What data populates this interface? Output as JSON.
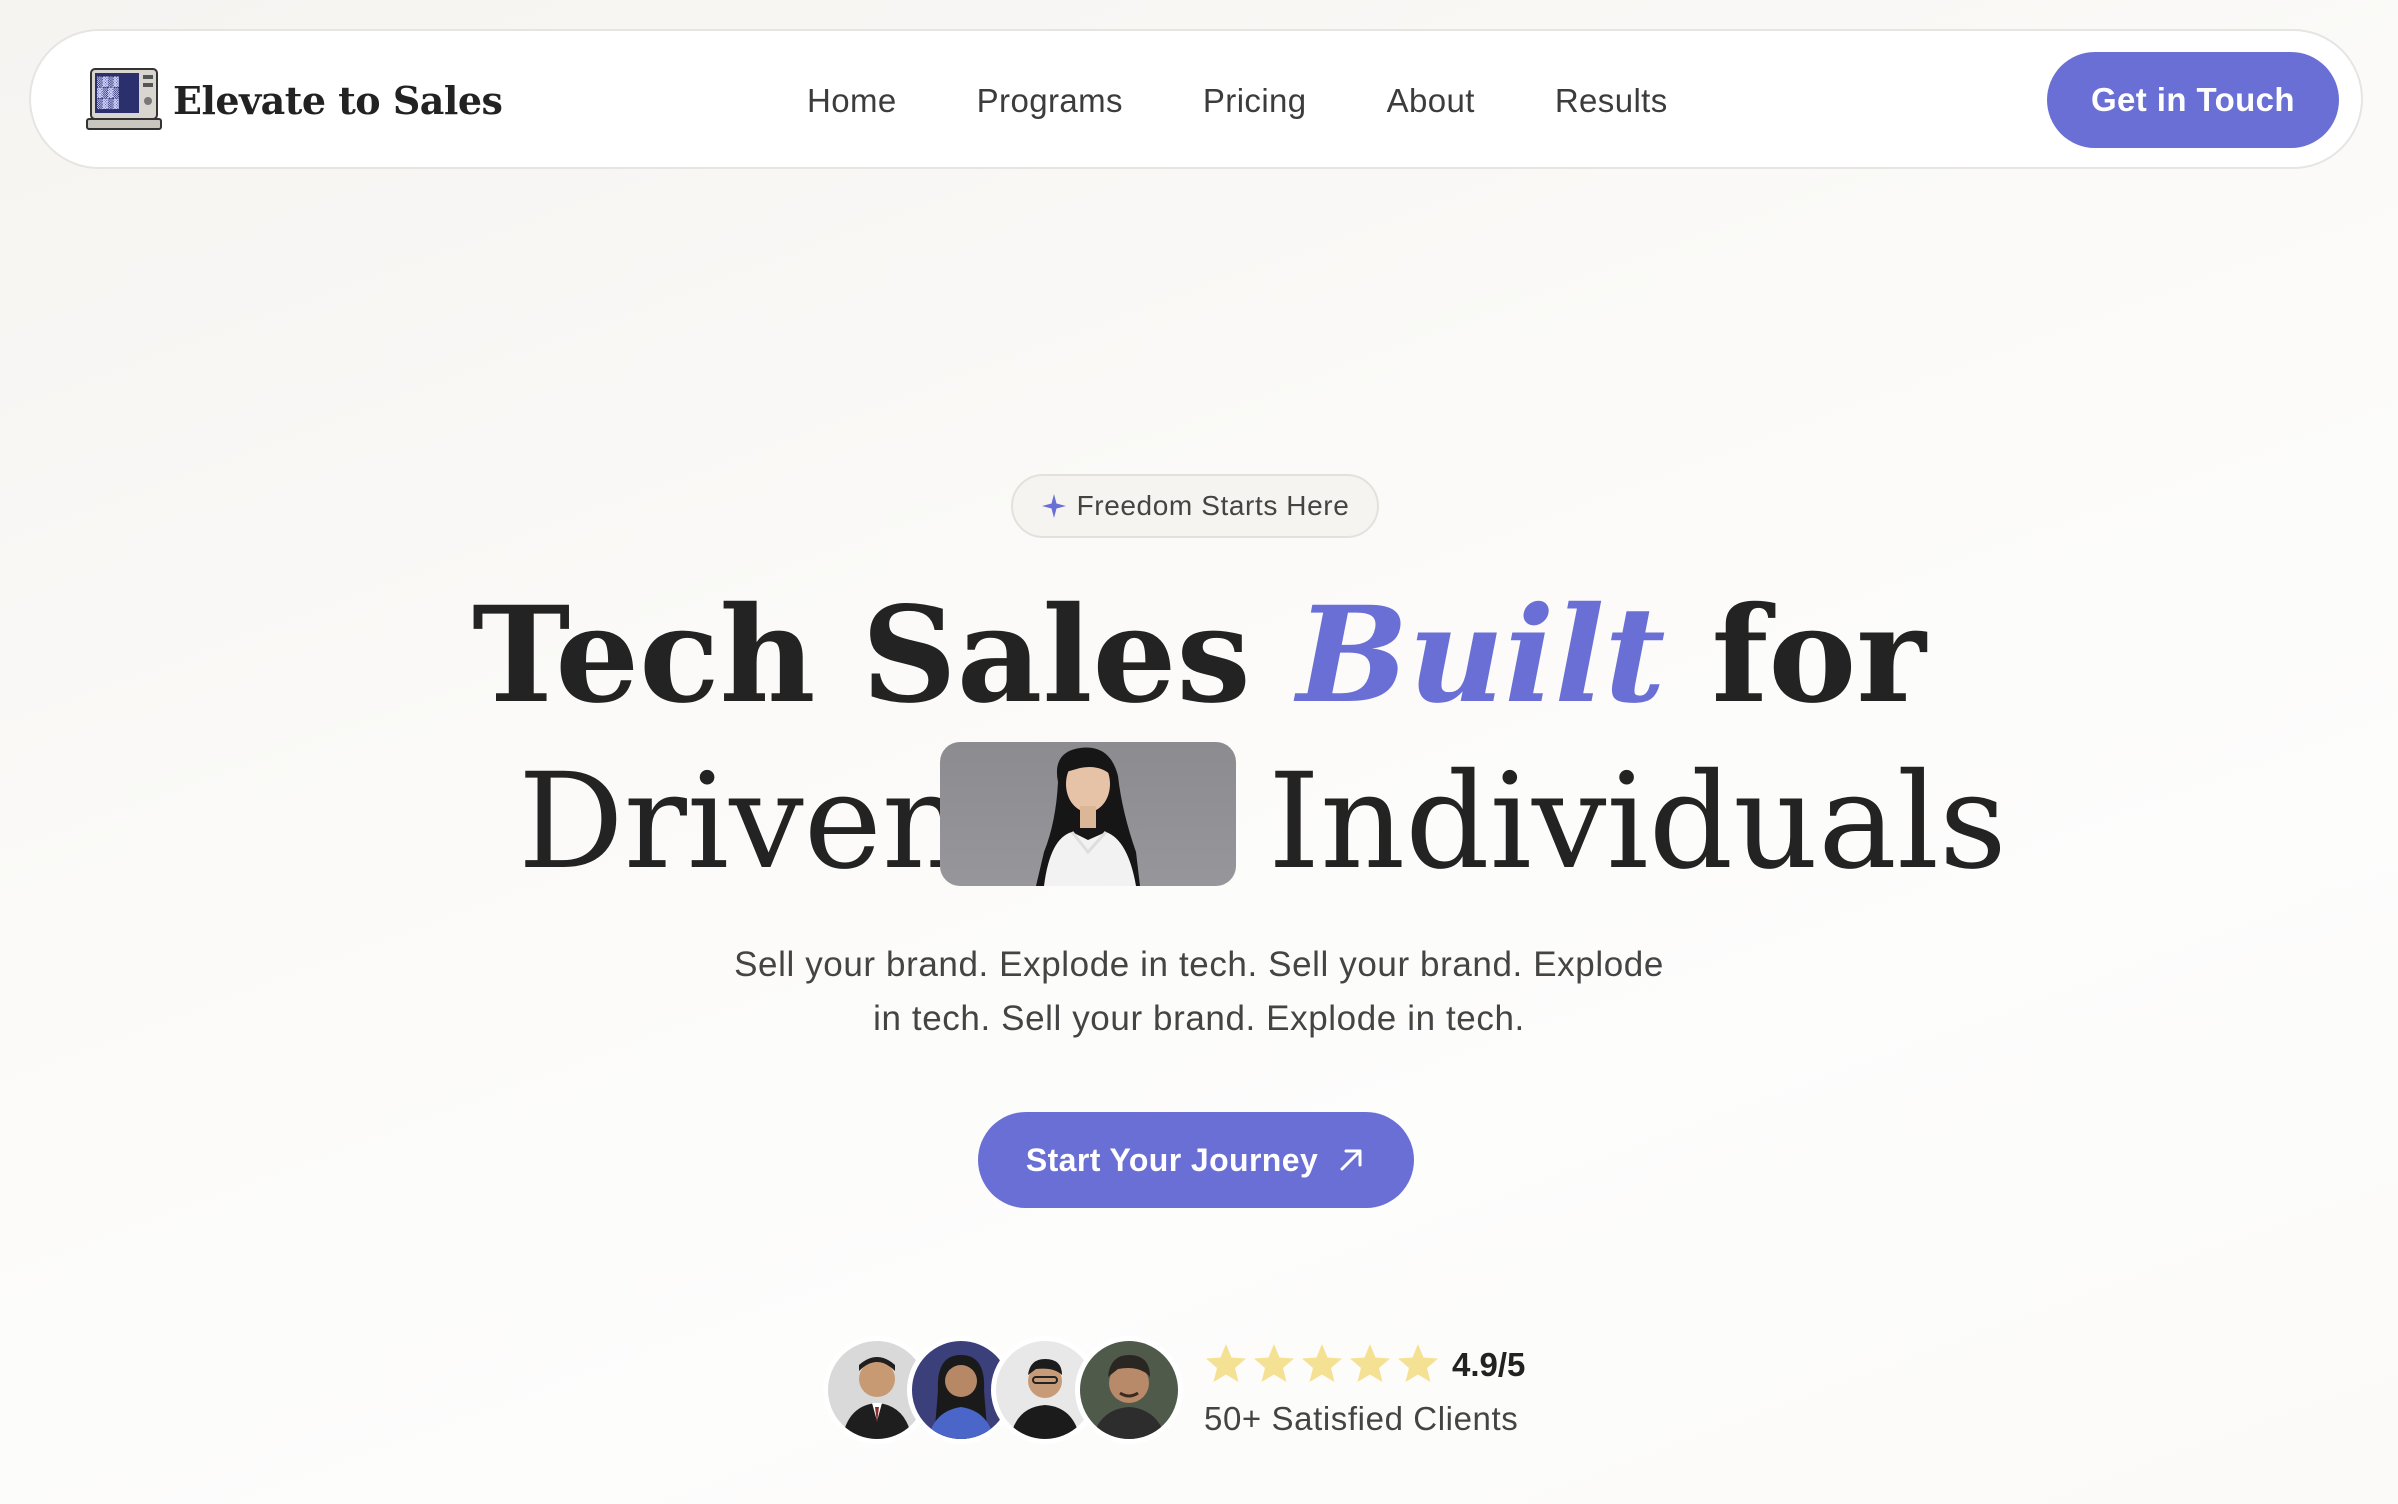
{
  "brand": {
    "name": "Elevate to Sales",
    "logo_icon": "retro-computer-icon"
  },
  "nav": {
    "items": [
      {
        "label": "Home"
      },
      {
        "label": "Programs"
      },
      {
        "label": "Pricing"
      },
      {
        "label": "About"
      },
      {
        "label": "Results"
      }
    ],
    "cta_label": "Get in Touch"
  },
  "hero": {
    "badge_icon": "sparkle-icon",
    "badge_text": "Freedom Starts Here",
    "title_line1_part1": "Tech Sales",
    "title_line1_accent": "Built",
    "title_line1_part2": "for",
    "title_line2_part1": "Driven",
    "title_line2_part2": "Individuals",
    "subtitle_line1": "Sell your brand. Explode in tech. Sell your brand. Explode",
    "subtitle_line2": "in tech. Sell your brand. Explode in tech.",
    "cta_label": "Start Your Journey",
    "cta_icon": "arrow-up-right-icon"
  },
  "social_proof": {
    "star_count": 5,
    "rating": "4.9/5",
    "clients_text": "50+ Satisfied Clients"
  },
  "colors": {
    "accent": "#6a6fd6",
    "star": "#f5e193",
    "text": "#232323"
  }
}
